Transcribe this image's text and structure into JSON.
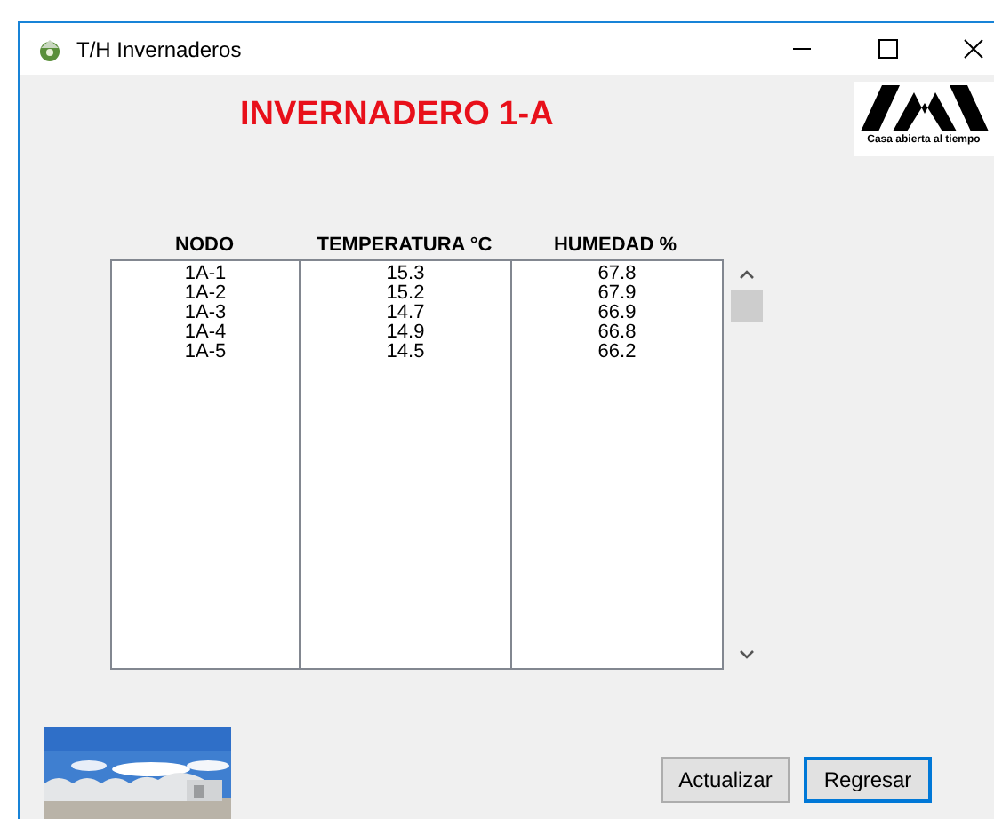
{
  "window": {
    "title": "T/H Invernaderos"
  },
  "heading": "INVERNADERO 1-A",
  "logo": {
    "tagline": "Casa abierta al tiempo"
  },
  "table": {
    "columns": [
      "NODO",
      "TEMPERATURA °C",
      "HUMEDAD %"
    ],
    "rows": [
      [
        "1A-1",
        "15.3",
        "67.8"
      ],
      [
        "1A-2",
        "15.2",
        "67.9"
      ],
      [
        "1A-3",
        "14.7",
        "66.9"
      ],
      [
        "1A-4",
        "14.9",
        "66.8"
      ],
      [
        "1A-5",
        "14.5",
        "66.2"
      ]
    ]
  },
  "buttons": [
    {
      "label": "Actualizar",
      "selected": false
    },
    {
      "label": "Regresar",
      "selected": true
    }
  ]
}
